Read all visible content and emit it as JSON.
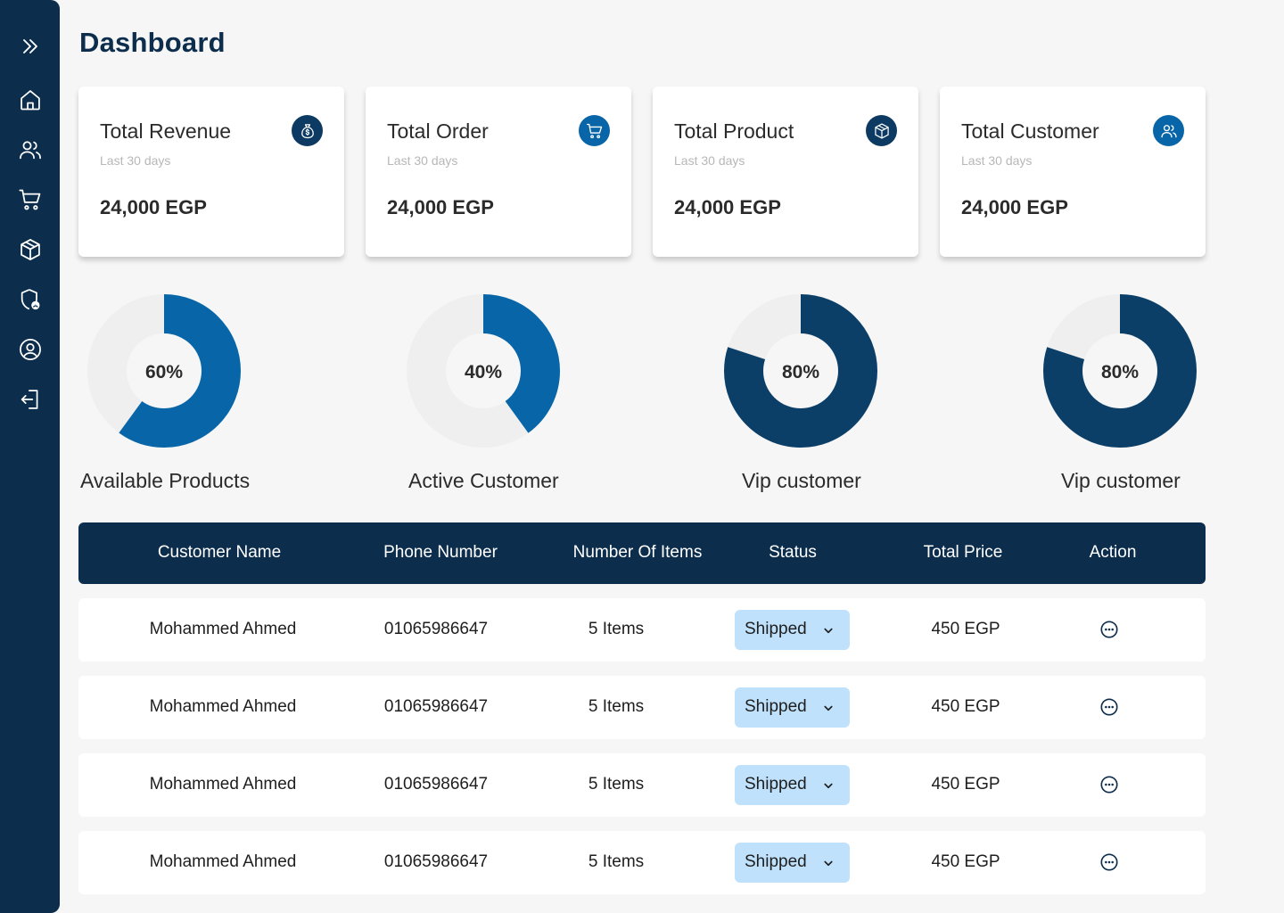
{
  "page": {
    "title": "Dashboard"
  },
  "sidebar": {
    "items": [
      {
        "icon": "expand-icon"
      },
      {
        "icon": "home-icon"
      },
      {
        "icon": "users-icon"
      },
      {
        "icon": "cart-icon"
      },
      {
        "icon": "box-icon"
      },
      {
        "icon": "shield-user-icon"
      },
      {
        "icon": "profile-icon"
      },
      {
        "icon": "logout-icon"
      }
    ]
  },
  "cards": [
    {
      "title": "Total Revenue",
      "subtitle": "Last 30 days",
      "value": "24,000 EGP",
      "icon": "money-bag-icon",
      "icon_color": "#0c3a63"
    },
    {
      "title": "Total Order",
      "subtitle": "Last 30 days",
      "value": "24,000 EGP",
      "icon": "cart-icon",
      "icon_color": "#0866a8"
    },
    {
      "title": "Total Product",
      "subtitle": "Last 30 days",
      "value": "24,000 EGP",
      "icon": "box-icon",
      "icon_color": "#0c3a63"
    },
    {
      "title": "Total Customer",
      "subtitle": "Last 30 days",
      "value": "24,000 EGP",
      "icon": "users-icon",
      "icon_color": "#0866a8"
    }
  ],
  "donuts": [
    {
      "percent": 60,
      "label_text": "60%",
      "label": "Available Products",
      "color": "#0866a8"
    },
    {
      "percent": 40,
      "label_text": "40%",
      "label": "Active Customer",
      "color": "#0866a8"
    },
    {
      "percent": 80,
      "label_text": "80%",
      "label": "Vip customer",
      "color": "#0c3f68"
    },
    {
      "percent": 80,
      "label_text": "80%",
      "label": "Vip customer",
      "color": "#0c3f68"
    }
  ],
  "table": {
    "headers": [
      "Customer Name",
      "Phone Number",
      "Number Of Items",
      "Status",
      "Total  Price",
      "Action"
    ],
    "rows": [
      {
        "name": "Mohammed Ahmed",
        "phone": "01065986647",
        "items": "5 Items",
        "status": "Shipped",
        "price": "450 EGP"
      },
      {
        "name": "Mohammed Ahmed",
        "phone": "01065986647",
        "items": "5 Items",
        "status": "Shipped",
        "price": "450 EGP"
      },
      {
        "name": "Mohammed Ahmed",
        "phone": "01065986647",
        "items": "5 Items",
        "status": "Shipped",
        "price": "450 EGP"
      },
      {
        "name": "Mohammed Ahmed",
        "phone": "01065986647",
        "items": "5 Items",
        "status": "Shipped",
        "price": "450 EGP"
      }
    ]
  },
  "colors": {
    "sidebar": "#0c2d4b",
    "track": "#efefef",
    "status_bg": "#bfe1fb"
  }
}
